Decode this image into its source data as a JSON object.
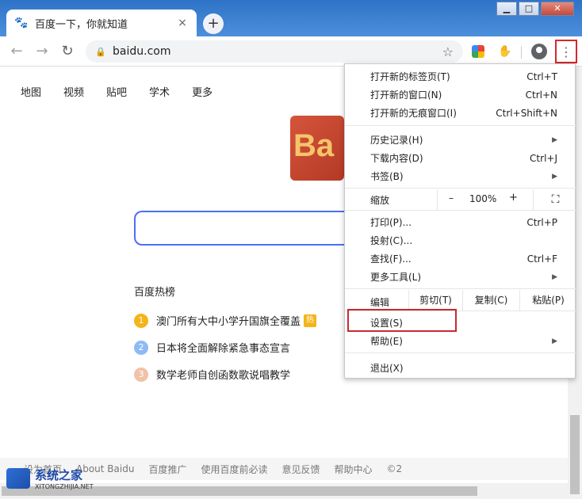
{
  "tab": {
    "title": "百度一下，你就知道",
    "close": "×"
  },
  "newtab": "+",
  "window": {
    "minimize": "▁",
    "maximize": "□",
    "close": "✕"
  },
  "toolbar": {
    "back": "←",
    "forward": "→",
    "reload": "↻",
    "lock": "🔒",
    "url": "baidu.com",
    "star": "☆",
    "menu": "⋮",
    "hand": "✋"
  },
  "page": {
    "topnav": [
      "地图",
      "视频",
      "贴吧",
      "学术",
      "更多"
    ],
    "logo": "Ba",
    "hot_title": "百度热榜",
    "hot_items": [
      {
        "num": "1",
        "text": "澳门所有大中小学升国旗全覆盖",
        "tag": "热",
        "color": "#f5b417"
      },
      {
        "num": "2",
        "text": "日本将全面解除紧急事态宣言",
        "color": "#8eb9f5"
      },
      {
        "num": "3",
        "text": "数学老师自创函数歌说唱教学",
        "color": "#f0c2a8"
      }
    ],
    "footer": [
      "设为首页",
      "About Baidu",
      "百度推广",
      "使用百度前必读",
      "意见反馈",
      "帮助中心",
      "©2"
    ]
  },
  "watermark": {
    "cn": "系统之家",
    "en": "XITONGZHIJIA.NET"
  },
  "menu": {
    "new_tab": {
      "label": "打开新的标签页(T)",
      "shortcut": "Ctrl+T"
    },
    "new_window": {
      "label": "打开新的窗口(N)",
      "shortcut": "Ctrl+N"
    },
    "new_incognito": {
      "label": "打开新的无痕窗口(I)",
      "shortcut": "Ctrl+Shift+N"
    },
    "history": {
      "label": "历史记录(H)",
      "arrow": "▶"
    },
    "downloads": {
      "label": "下载内容(D)",
      "shortcut": "Ctrl+J"
    },
    "bookmarks": {
      "label": "书签(B)",
      "arrow": "▶"
    },
    "zoom": {
      "label": "缩放",
      "minus": "–",
      "value": "100%",
      "plus": "+",
      "fullscreen": "⛶"
    },
    "print": {
      "label": "打印(P)...",
      "shortcut": "Ctrl+P"
    },
    "cast": {
      "label": "投射(C)..."
    },
    "find": {
      "label": "查找(F)...",
      "shortcut": "Ctrl+F"
    },
    "more_tools": {
      "label": "更多工具(L)",
      "arrow": "▶"
    },
    "edit": {
      "label": "编辑",
      "cut": "剪切(T)",
      "copy": "复制(C)",
      "paste": "粘贴(P)"
    },
    "settings": {
      "label": "设置(S)"
    },
    "help": {
      "label": "帮助(E)",
      "arrow": "▶"
    },
    "exit": {
      "label": "退出(X)"
    }
  }
}
